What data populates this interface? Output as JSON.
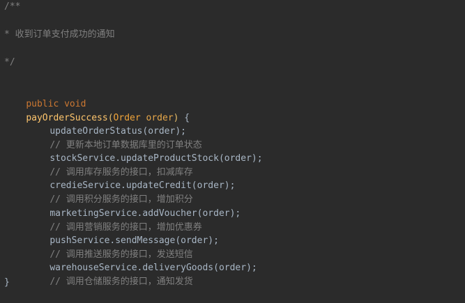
{
  "code": {
    "doc_open": "/**",
    "doc_line": "* 收到订单支付成功的通知",
    "doc_close": "*/",
    "signature": {
      "modifiers": "public void",
      "method": "payOrderSuccess",
      "open_paren": "(",
      "param_type": "Order",
      "param_name": "order",
      "close_paren": ")",
      "open_brace": " {"
    },
    "statements": [
      {
        "call": "updateOrderStatus(order);",
        "comment": "// 更新本地订单数据库里的订单状态"
      },
      {
        "call": "stockService.updateProductStock(order);",
        "comment": "// 调用库存服务的接口，扣减库存"
      },
      {
        "call": "credieService.updateCredit(order);",
        "comment": "// 调用积分服务的接口，增加积分"
      },
      {
        "call": "marketingService.addVoucher(order);",
        "comment": "// 调用营销服务的接口，增加优惠券"
      },
      {
        "call": "pushService.sendMessage(order);",
        "comment": "// 调用推送服务的接口，发送短信"
      },
      {
        "call": "warehouseService.deliveryGoods(order);",
        "comment": "// 调用仓储服务的接口，通知发货"
      }
    ],
    "close_brace": "}"
  }
}
